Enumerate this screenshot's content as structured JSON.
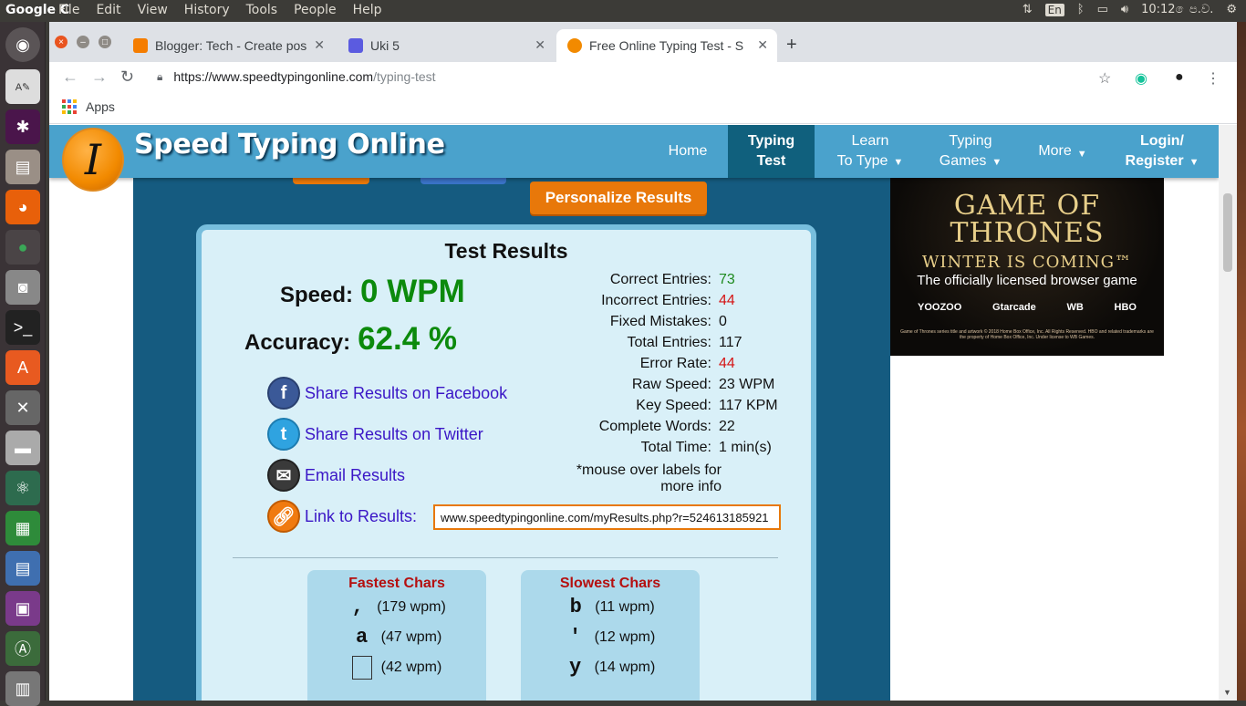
{
  "os": {
    "app_name": "Google C",
    "menus": [
      "File",
      "Edit",
      "View",
      "History",
      "Tools",
      "People",
      "Help"
    ],
    "lang": "En",
    "clock": "10:12 ෙප.ව."
  },
  "browser": {
    "tabs": [
      {
        "title": "Blogger: Tech - Create pos",
        "close": "✕"
      },
      {
        "title": "Uki 5",
        "close": "✕"
      },
      {
        "title": "Free Online Typing Test - S",
        "close": "✕"
      }
    ],
    "new_tab": "+",
    "url_host": "https://www.speedtypingonline.com",
    "url_path": "/typing-test",
    "bookmarks_apps": "Apps"
  },
  "site": {
    "logo_letter": "I",
    "name": "Speed Typing Online",
    "nav": {
      "home": "Home",
      "typing_test_1": "Typing",
      "typing_test_2": "Test",
      "learn_1": "Learn",
      "learn_2": "To Type",
      "games_1": "Typing",
      "games_2": "Games",
      "more": "More",
      "login_1": "Login/",
      "login_2": "Register",
      "dropdown": "▼"
    },
    "personalize": "Personalize Results"
  },
  "results": {
    "title": "Test Results",
    "speed_label": "Speed:",
    "speed_value": "0 WPM",
    "accuracy_label": "Accuracy:",
    "accuracy_value": "62.4 %",
    "stats": [
      {
        "label": "Correct Entries:",
        "value": "73"
      },
      {
        "label": "Incorrect Entries:",
        "value": "44"
      },
      {
        "label": "Fixed Mistakes:",
        "value": "0"
      },
      {
        "label": "Total Entries:",
        "value": "117"
      },
      {
        "label": "Error Rate:",
        "value": "44"
      },
      {
        "label": "Raw Speed:",
        "value": "23 WPM"
      },
      {
        "label": "Key Speed:",
        "value": "117 KPM"
      },
      {
        "label": "Complete Words:",
        "value": "22"
      },
      {
        "label": "Total Time:",
        "value": "1 min(s)"
      }
    ],
    "note_1": "*mouse over labels for",
    "note_2": "more info",
    "share_facebook": "Share Results on Facebook",
    "share_twitter": "Share Results on Twitter",
    "email": "Email Results",
    "link_label": "Link to Results:",
    "link_value": "www.speedtypingonline.com/myResults.php?r=524613185921",
    "fastest": {
      "title": "Fastest Chars",
      "rows": [
        {
          "char": ",",
          "wpm": "(179 wpm)"
        },
        {
          "char": "a",
          "wpm": "(47 wpm)"
        },
        {
          "char": "",
          "wpm": "(42 wpm)"
        }
      ]
    },
    "slowest": {
      "title": "Slowest Chars",
      "rows": [
        {
          "char": "b",
          "wpm": "(11 wpm)"
        },
        {
          "char": "'",
          "wpm": "(12 wpm)"
        },
        {
          "char": "y",
          "wpm": "(14 wpm)"
        }
      ]
    }
  },
  "ad": {
    "line1": "GAME OF",
    "line2": "THRONES",
    "line3": "WINTER IS COMING™",
    "line4": "The officially licensed browser game",
    "brands": [
      "YOOZOO",
      "Gtarcade",
      "WB",
      "HBO"
    ],
    "fine": "Game of Thrones series title and artwork © 2018 Home Box Office, Inc. All Rights Reserved. HBO and related trademarks are the property of Home Box Office, Inc. Under license to WB Games."
  },
  "colors": {
    "accent": "#4aa2cc",
    "orange": "#e8780a",
    "green": "#0c8a0c",
    "red": "#d51515"
  }
}
